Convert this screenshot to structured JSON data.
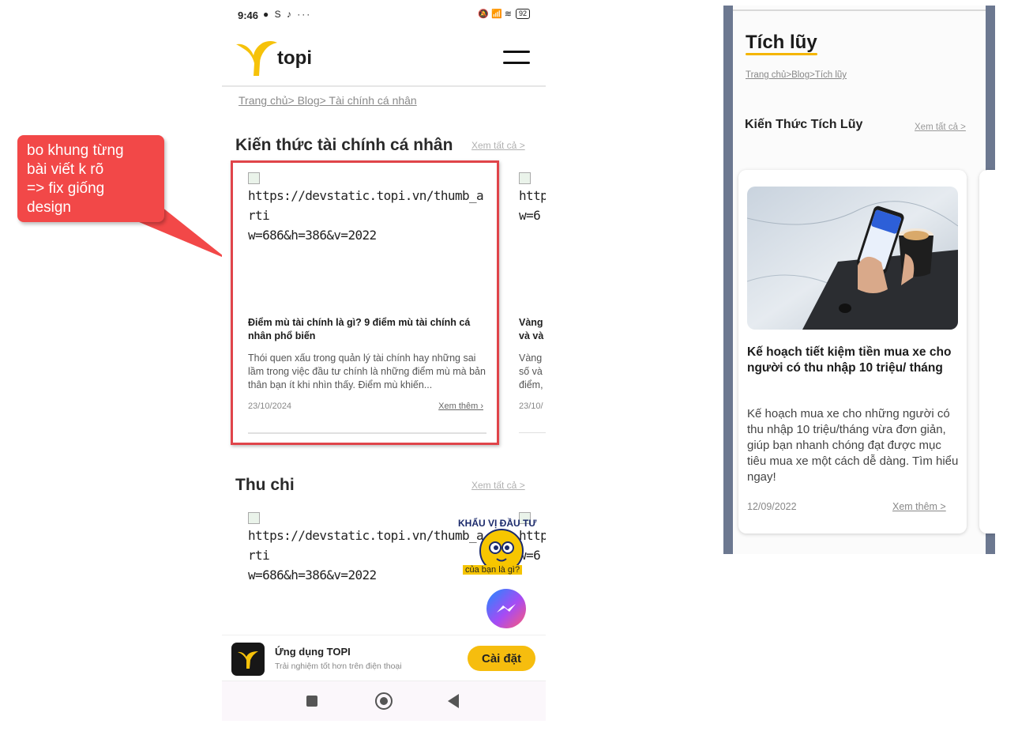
{
  "annotation": {
    "text": "bo khung từng\nbài viết k rõ\n=> fix giống\ndesign",
    "color": "#f24848"
  },
  "status_bar": {
    "time": "9:46",
    "app_icons": "● S ♪ ···",
    "right_icons": "🔕 📶 ≋",
    "battery": "92"
  },
  "header": {
    "brand": "topi",
    "logo_icon": "topi-logo-icon",
    "menu_icon": "hamburger-menu-icon"
  },
  "breadcrumb": "Trang chủ> Blog> Tài chính cá nhân",
  "sections": [
    {
      "title": "Kiến thức tài chính cá nhân",
      "see_all": "Xem tất cả >",
      "cards": [
        {
          "image_alt": "https://devstatic.topi.vn/thumb_arti\nw=686&h=386&v=2022",
          "title": "Điểm mù tài chính là gì? 9 điểm mù tài chính cá nhân phổ biến",
          "description": "Thói quen xấu trong quản lý tài chính hay những sai lầm trong việc đầu tư chính là những điểm mù mà bản thân bạn ít khi nhìn thấy. Điểm mù khiến...",
          "date": "23/10/2024",
          "more": "Xem thêm ›"
        },
        {
          "image_alt": "http\nw=6",
          "title": "Vàng\nvà và",
          "description": "Vàng\nsố và\nđiểm,",
          "date": "23/10/"
        }
      ]
    },
    {
      "title": "Thu chi",
      "see_all": "Xem tất cả >",
      "cards": [
        {
          "image_alt": "https://devstatic.topi.vn/thumb_arti\nw=686&h=386&v=2022"
        },
        {
          "image_alt": "http\nw=6"
        }
      ]
    }
  ],
  "promo": {
    "top_text": "KHẨU VỊ ĐẦU TƯ",
    "bottom_text": "của bạn là gì?"
  },
  "messenger_icon": "messenger-icon",
  "app_banner": {
    "name": "Ứng dụng TOPI",
    "subtitle": "Trải nghiệm tốt hơn trên điện thoại",
    "install_label": "Cài đặt",
    "accent": "#f6bd0e"
  },
  "design_mock": {
    "title": "Tích lũy",
    "breadcrumb": "Trang chủ>Blog>Tích lũy",
    "section_title": "Kiến Thức Tích Lũy",
    "see_all": "Xem tất cả >",
    "card": {
      "title": "Kế hoạch tiết kiệm tiền mua xe cho người có thu nhập 10 triệu/ tháng",
      "description": "Kế hoạch mua xe cho những người có thu nhập 10 triệu/tháng vừa đơn giản, giúp bạn nhanh chóng đạt được mục tiêu mua xe một cách dễ dàng. Tìm hiểu ngay!",
      "date": "12/09/2022",
      "more": "Xem thêm >"
    },
    "accent": "#f4b500"
  }
}
